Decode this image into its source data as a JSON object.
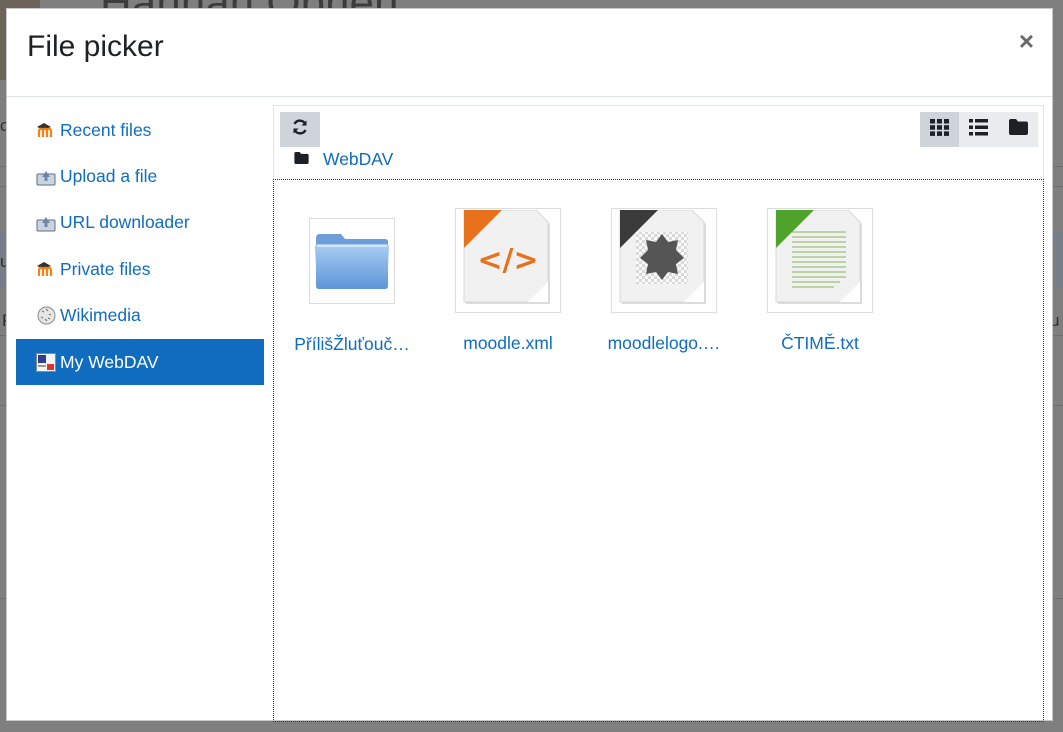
{
  "background": {
    "title": "Hannah Obrien",
    "fragments": [
      "o",
      "u",
      "P",
      "u"
    ]
  },
  "modal": {
    "title": "File picker",
    "close_label": "×"
  },
  "sidebar": {
    "items": [
      {
        "label": "Recent files",
        "icon": "moodle-icon"
      },
      {
        "label": "Upload a file",
        "icon": "upload-icon"
      },
      {
        "label": "URL downloader",
        "icon": "url-download-icon"
      },
      {
        "label": "Private files",
        "icon": "moodle-icon"
      },
      {
        "label": "Wikimedia",
        "icon": "wikimedia-icon"
      },
      {
        "label": "My WebDAV",
        "icon": "webdav-icon",
        "active": true
      }
    ]
  },
  "toolbar": {
    "refresh_icon": "refresh-icon",
    "views": [
      "grid-view-icon",
      "list-view-icon",
      "folder-view-icon"
    ],
    "active_view": "grid-view-icon"
  },
  "breadcrumb": {
    "label": "WebDAV",
    "icon": "folder-icon"
  },
  "files": [
    {
      "name": "PřílišŽluťouč…",
      "type": "folder"
    },
    {
      "name": "moodle.xml",
      "type": "xml"
    },
    {
      "name": "moodlelogo.…",
      "type": "image"
    },
    {
      "name": "ČTIMĚ.txt",
      "type": "text"
    }
  ],
  "colors": {
    "accent": "#0f6cbf",
    "active_bg": "#0f6cbf",
    "button_bg": "#ced4da"
  }
}
